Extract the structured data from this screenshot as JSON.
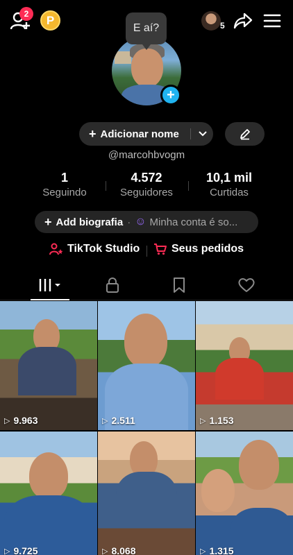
{
  "topbar": {
    "notification_count": "2",
    "coin_label": "P",
    "mini_avatar_count": "5",
    "icons": [
      "add-friend-icon",
      "coin-icon",
      "share-icon",
      "menu-icon"
    ]
  },
  "bubble_text": "E aí?",
  "profile": {
    "add_name_label": "Adicionar nome",
    "username": "@marcohbvogm"
  },
  "stats": [
    {
      "value": "1",
      "label": "Seguindo"
    },
    {
      "value": "4.572",
      "label": "Seguidores"
    },
    {
      "value": "10,1 mil",
      "label": "Curtidas"
    }
  ],
  "bio": {
    "add_label": "Add biografia",
    "account_text": "Minha conta é so..."
  },
  "links": {
    "studio_label": "TikTok Studio",
    "orders_label": "Seus pedidos"
  },
  "tabs": [
    "videos",
    "private",
    "favorites",
    "liked"
  ],
  "videos": [
    {
      "views": "9.963"
    },
    {
      "views": "2.511"
    },
    {
      "views": "1.153"
    },
    {
      "views": "9.725"
    },
    {
      "views": "8.068"
    },
    {
      "views": "1.315"
    }
  ],
  "colors": {
    "accent_red": "#fe2c55",
    "plus_blue": "#20b3f0",
    "coin_gold": "#f5b82e"
  }
}
